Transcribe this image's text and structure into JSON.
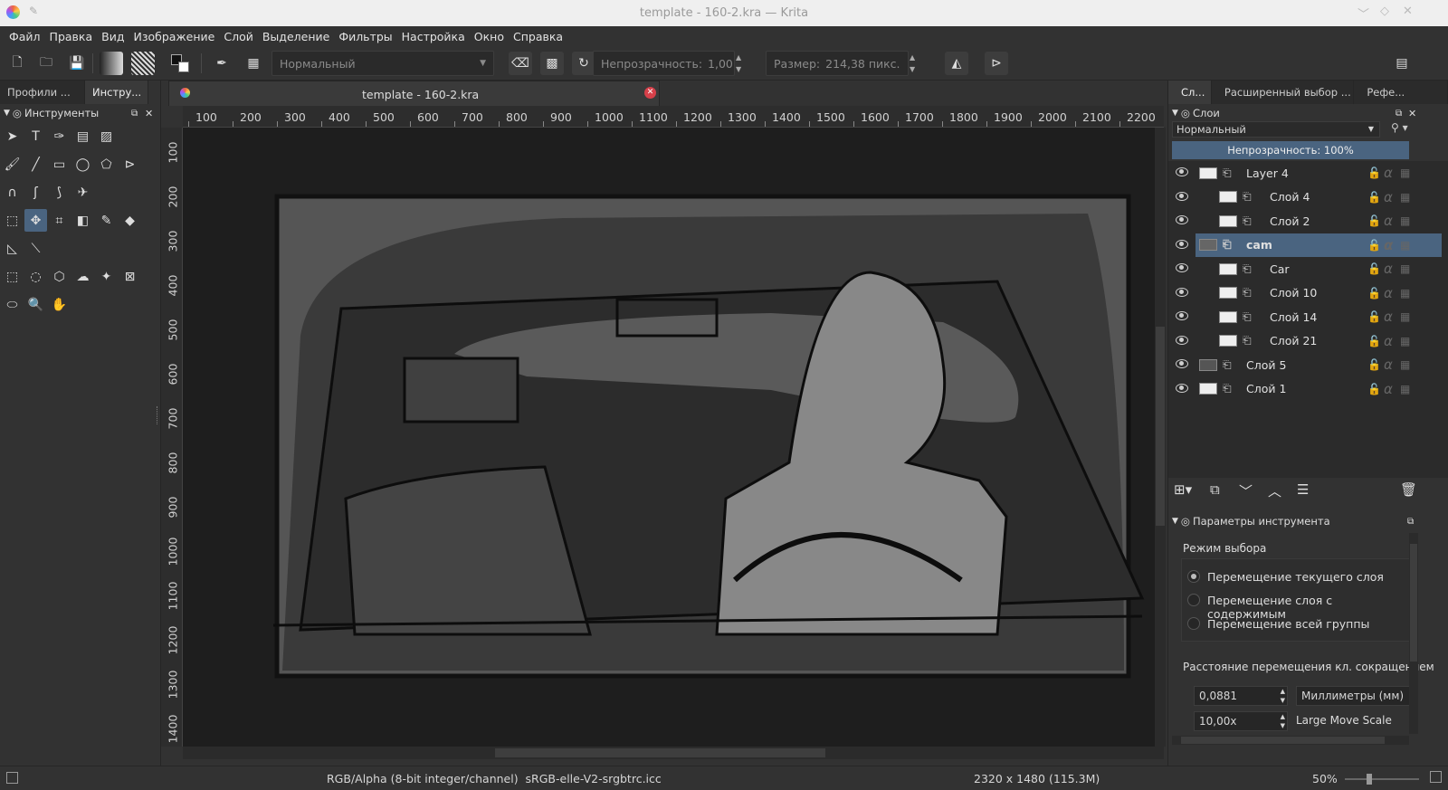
{
  "window": {
    "title": "template - 160-2.kra  — Krita"
  },
  "menu": [
    "Файл",
    "Правка",
    "Вид",
    "Изображение",
    "Слой",
    "Выделение",
    "Фильтры",
    "Настройка",
    "Окно",
    "Справка"
  ],
  "toolbar": {
    "blend_mode": "Нормальный",
    "opacity_label": "Непрозрачность:",
    "opacity_value": "1,00",
    "size_label": "Размер:",
    "size_value": "214,38 пикс."
  },
  "left_dock": {
    "tabs": [
      "Профили ...",
      "Инстру..."
    ],
    "header": "Инструменты"
  },
  "document": {
    "tab_title": "template - 160-2.kra"
  },
  "ruler": {
    "h_ticks": [
      "100",
      "200",
      "300",
      "400",
      "500",
      "600",
      "700",
      "800",
      "900",
      "1000",
      "1100",
      "1200",
      "1300",
      "1400",
      "1500",
      "1600",
      "1700",
      "1800",
      "1900",
      "2000",
      "2100",
      "2200"
    ],
    "v_ticks": [
      "100",
      "200",
      "300",
      "400",
      "500",
      "600",
      "700",
      "800",
      "900",
      "1000",
      "1100",
      "1200",
      "1300",
      "1400"
    ]
  },
  "right_dock": {
    "tabs": [
      "Сл...",
      "Расширенный выбор ...",
      "Рефе..."
    ],
    "layers_header": "Слои",
    "blend_mode": "Нормальный",
    "opacity": "Непрозрачность:  100%",
    "layers": [
      {
        "name": "Layer 4",
        "indent": 0,
        "selected": false
      },
      {
        "name": "Слой 4",
        "indent": 1,
        "selected": false
      },
      {
        "name": "Слой 2",
        "indent": 1,
        "selected": false
      },
      {
        "name": "cam",
        "indent": 0,
        "selected": true
      },
      {
        "name": "Car",
        "indent": 1,
        "selected": false
      },
      {
        "name": "Слой 10",
        "indent": 1,
        "selected": false
      },
      {
        "name": "Слой 14",
        "indent": 1,
        "selected": false
      },
      {
        "name": "Слой 21",
        "indent": 1,
        "selected": false
      },
      {
        "name": "Слой 5",
        "indent": 0,
        "selected": false
      },
      {
        "name": "Слой 1",
        "indent": 0,
        "selected": false
      }
    ],
    "tool_options_header": "Параметры инструмента",
    "selection_mode_label": "Режим выбора",
    "modes": [
      "Перемещение текущего слоя",
      "Перемещение слоя с содержимым",
      "Перемещение всей группы"
    ],
    "shortcut_label": "Расстояние перемещения кл. сокращением",
    "move_value": "0,0881",
    "unit": "Миллиметры (мм)",
    "scale_value": "10,00x",
    "scale_label": "Large Move Scale"
  },
  "status": {
    "color_info": "RGB/Alpha (8-bit integer/channel)  sRGB-elle-V2-srgbtrc.icc",
    "dimensions": "2320 x 1480 (115.3M)",
    "zoom": "50%"
  }
}
